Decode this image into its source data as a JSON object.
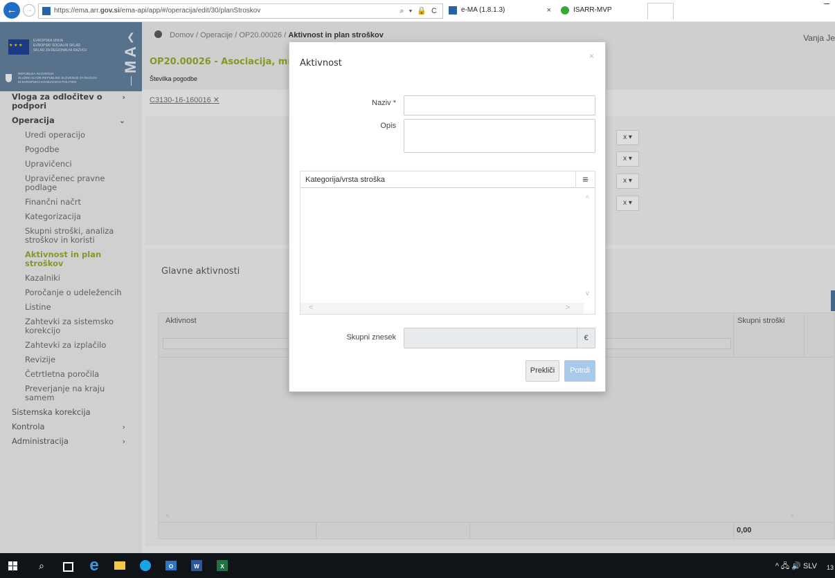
{
  "browser": {
    "url": "https://ema.arr.gov.si/ema-api/app/#/operacija/edit/30/planStroskov",
    "url_prefix": "https://ema.arr.",
    "url_domain": "gov.si",
    "url_rest": "/ema-api/app/#/operacija/edit/30/planStroskov",
    "address_tools": "⌕ ▾ 🔒 C",
    "tabs": [
      {
        "label": "e-MA (1.8.1.3)",
        "close": "×"
      },
      {
        "label": "ISARR-MVP"
      }
    ],
    "back_icon": "arrow-left-icon",
    "forward_icon": "arrow-right-icon",
    "minimize": "–"
  },
  "logo": {
    "eu_line1": "EVROPSKA UNIJA",
    "eu_line2": "EVROPSKI SOCIALNI SKLAD",
    "eu_line3": "SKLAD ZA REGIONALNI RAZVOJ",
    "rs_line1": "REPUBLIKA SLOVENIJA",
    "rs_line2": "SLUŽBA VLADE REPUBLIKE SLOVENIJE ZA RAZVOJ",
    "rs_line3": "IN EVROPSKO KOHEZIJSKO POLITIKO",
    "app_letters": [
      "e",
      "M",
      "A"
    ],
    "collapse_icon": "chevron-left-icon"
  },
  "sidebar": {
    "items": [
      {
        "label": "Vloga za odločitev o podpori",
        "type": "group",
        "chevron": "›"
      },
      {
        "label": "Operacija",
        "type": "group",
        "chevron": "⌄"
      },
      {
        "label": "Uredi operacijo",
        "type": "sub"
      },
      {
        "label": "Pogodbe",
        "type": "sub"
      },
      {
        "label": "Upravičenci",
        "type": "sub"
      },
      {
        "label": "Upravičenec pravne podlage",
        "type": "sub"
      },
      {
        "label": "Finančni načrt",
        "type": "sub"
      },
      {
        "label": "Kategorizacija",
        "type": "sub"
      },
      {
        "label": "Skupni stroški, analiza stroškov in koristi",
        "type": "sub"
      },
      {
        "label": "Aktivnost in plan stroškov",
        "type": "sub",
        "active": true
      },
      {
        "label": "Kazalniki",
        "type": "sub"
      },
      {
        "label": "Poročanje o udeležencih",
        "type": "sub"
      },
      {
        "label": "Listine",
        "type": "sub"
      },
      {
        "label": "Zahtevki za sistemsko korekcijo",
        "type": "sub"
      },
      {
        "label": "Zahtevki za izplačilo",
        "type": "sub"
      },
      {
        "label": "Revizije",
        "type": "sub"
      },
      {
        "label": "Četrtletna poročila",
        "type": "sub"
      },
      {
        "label": "Preverjanje na kraju samem",
        "type": "sub"
      },
      {
        "label": "Sistemska korekcija",
        "type": "plain"
      },
      {
        "label": "Kontrola",
        "type": "plain",
        "chevron": "›"
      },
      {
        "label": "Administracija",
        "type": "plain",
        "chevron": "›"
      }
    ]
  },
  "header": {
    "breadcrumb_home": "Domov",
    "breadcrumb_sep": "/",
    "breadcrumb_operacije": "Operacije",
    "breadcrumb_op": "OP20.00026",
    "breadcrumb_current": "Aktivnost in plan stroškov",
    "user": "Vanja Je",
    "op_title": "OP20.00026 - Asociacija, mreža NV",
    "contract_label": "Številka pogodbe",
    "contract_value": "C3130-16-160016",
    "contract_remove": "✕"
  },
  "card_buttons": [
    "x ▾",
    "x ▾",
    "x ▾",
    "x ▾"
  ],
  "main_section": {
    "title": "Glavne aktivnosti",
    "columns": [
      "Aktivnost",
      "Skupni stroški"
    ],
    "total": "0,00",
    "scroll_left": "<",
    "scroll_right": ">"
  },
  "modal": {
    "title": "Aktivnost",
    "close": "×",
    "name_label": "Naziv *",
    "name_value": "",
    "desc_label": "Opis",
    "desc_value": "",
    "category_header": "Kategorija/vrsta stroška",
    "category_menu": "≡",
    "scroll_up": "^",
    "scroll_down": "v",
    "scroll_left": "<",
    "scroll_right": ">",
    "sum_label": "Skupni znesek",
    "sum_value": "",
    "currency": "€",
    "cancel_label": "Prekliči",
    "confirm_label": "Potrdi"
  },
  "taskbar": {
    "search_icon": "⌕",
    "ie_glyph": "e",
    "outlook_label": "O",
    "word_label": "W",
    "excel_label": "X",
    "tray_text": "^ 🖧 🔊 SLV",
    "clock": "13"
  },
  "colors": {
    "accent_green": "#8aa32a",
    "confirm_blue": "#a9c9ea",
    "logo_blue": "#5e7a94"
  }
}
